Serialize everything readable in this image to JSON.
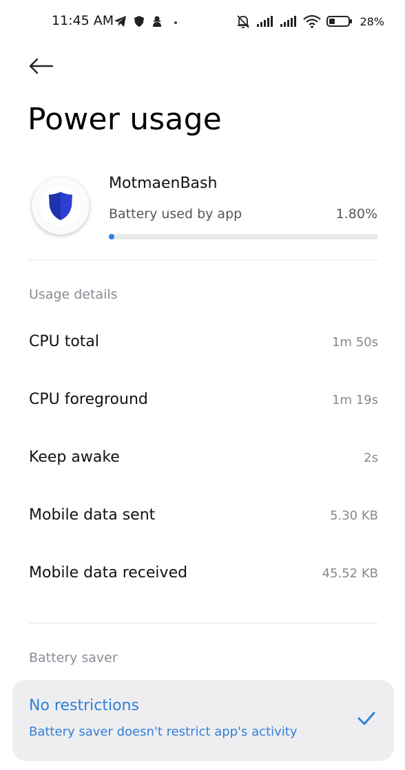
{
  "status_bar": {
    "time": "11:45 AM",
    "battery_percent": "28%",
    "left_icons": [
      "telegram-icon",
      "shield-icon",
      "incognito-icon",
      "dot-icon"
    ],
    "right_icons": [
      "bell-off-icon",
      "signal-icon",
      "signal-icon",
      "wifi-icon",
      "battery-icon"
    ]
  },
  "header": {
    "back_icon": "back-arrow-icon",
    "title": "Power usage"
  },
  "app": {
    "name": "MotmaenBash",
    "icon": "shield-icon",
    "battery_label": "Battery used by app",
    "battery_value": "1.80%",
    "battery_fraction": 0.018
  },
  "usage": {
    "header": "Usage details",
    "rows": [
      {
        "label": "CPU total",
        "value": "1m 50s"
      },
      {
        "label": "CPU foreground",
        "value": "1m 19s"
      },
      {
        "label": "Keep awake",
        "value": "2s"
      },
      {
        "label": "Mobile data sent",
        "value": "5.30 KB"
      },
      {
        "label": "Mobile data received",
        "value": "45.52 KB"
      }
    ]
  },
  "battery_saver": {
    "header": "Battery saver",
    "option_title": "No restrictions",
    "option_subtitle": "Battery saver doesn't restrict app's activity",
    "selected": true
  },
  "colors": {
    "accent": "#2f7fd8",
    "progress": "#2e7de1",
    "card_bg": "#eeeef1",
    "shield": "#2a3fd0"
  }
}
